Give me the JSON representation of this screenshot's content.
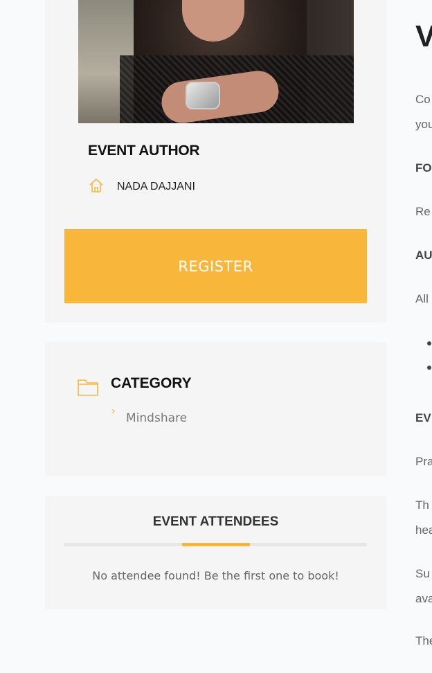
{
  "author": {
    "heading": "EVENT AUTHOR",
    "name": "NADA DAJJANI",
    "icon": "home-icon",
    "register_label": "REGISTER"
  },
  "category": {
    "heading": "CATEGORY",
    "icon": "folder-icon",
    "items": [
      {
        "label": "Mindshare"
      }
    ]
  },
  "attendees": {
    "heading": "EVENT ATTENDEES",
    "empty_message": "No attendee found! Be the first one to book!"
  },
  "main_content": {
    "title_fragment": "V",
    "lines": [
      "Co",
      "you",
      "FO",
      "Re",
      "AU",
      "All",
      "EV",
      "Pra",
      "Th",
      "hea",
      "Su",
      "ava",
      "The"
    ]
  },
  "colors": {
    "accent": "#f8b73a",
    "card_bg": "#f5f5f5",
    "page_bg": "#f9fafb"
  }
}
